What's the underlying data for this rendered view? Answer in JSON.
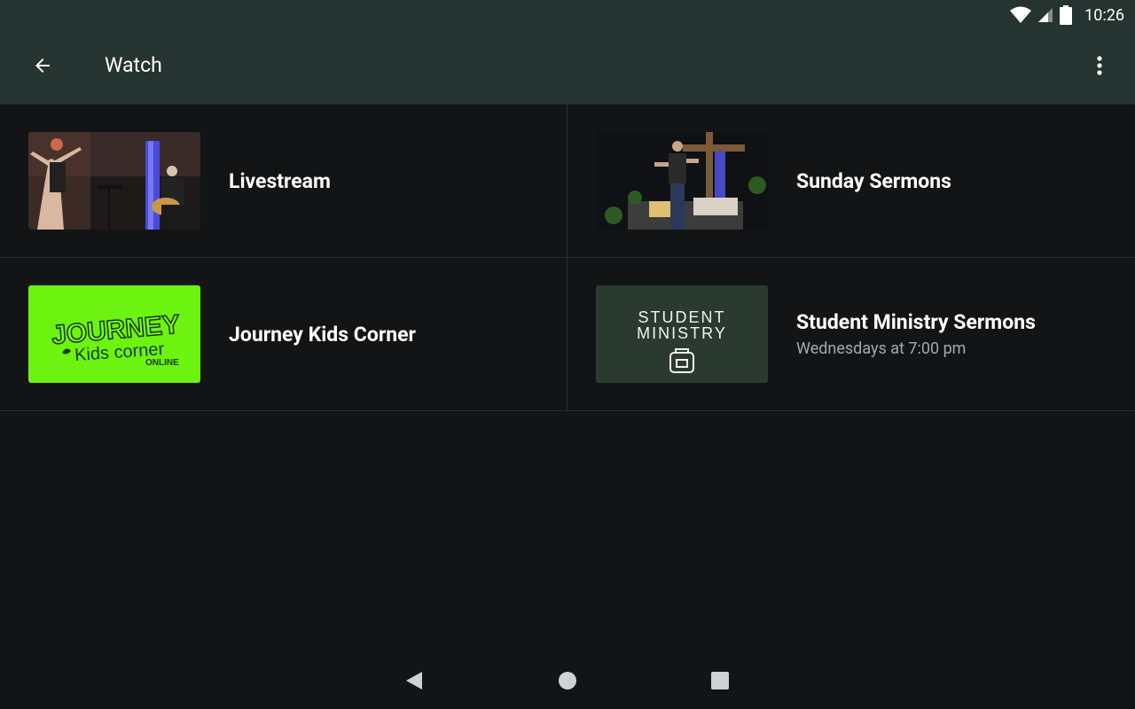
{
  "status": {
    "time": "10:26",
    "icons": [
      "wifi-icon",
      "cell-signal-icon",
      "battery-icon"
    ]
  },
  "appbar": {
    "title": "Watch",
    "back_icon": "arrow-back-icon",
    "menu_icon": "more-vert-icon"
  },
  "items": [
    {
      "title": "Livestream",
      "subtitle": "",
      "thumbnail": "livestream-photo"
    },
    {
      "title": "Sunday Sermons",
      "subtitle": "",
      "thumbnail": "sermon-photo"
    },
    {
      "title": "Journey Kids Corner",
      "subtitle": "",
      "thumbnail": "journey-kids-logo",
      "thumb_text": {
        "line1": "JOURNEY",
        "line2": "Kids corner",
        "line3": "ONLINE"
      }
    },
    {
      "title": "Student Ministry Sermons",
      "subtitle": "Wednesdays at 7:00 pm",
      "thumbnail": "student-ministry-logo",
      "thumb_text": {
        "line1": "STUDENT",
        "line2": "MINISTRY"
      }
    }
  ],
  "colors": {
    "appbar": "#253331",
    "background": "#121416",
    "kids_green": "#6cf410",
    "student_green": "#2b3a2f"
  },
  "navigation": [
    "back-nav-icon",
    "home-nav-icon",
    "recents-nav-icon"
  ]
}
